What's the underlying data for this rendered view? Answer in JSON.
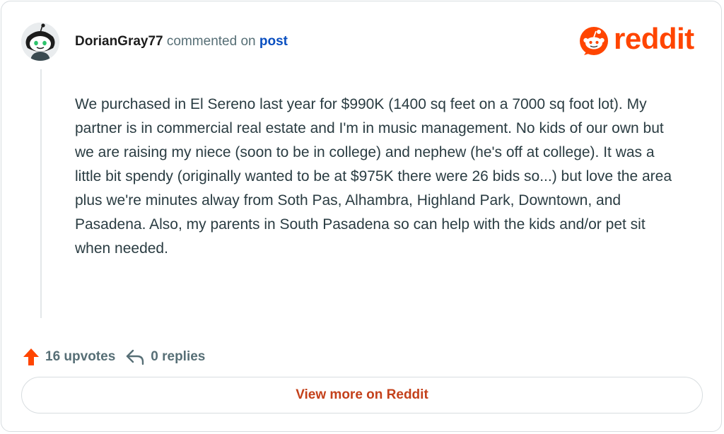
{
  "comment": {
    "author": "DorianGray77",
    "action_text": "commented on",
    "post_link": "post",
    "body": "We purchased in El Sereno last year for $990K (1400 sq feet on a 7000 sq foot lot). My partner is in commercial real estate and I'm in music management. No kids of our own but we are raising my niece (soon to be in college) and nephew (he's off at college). It was a little bit spendy (originally wanted to be at $975K there were 26 bids so...) but love the area plus we're minutes alway from Soth Pas, Alhambra, Highland Park, Downtown, and Pasadena. Also, my parents in South Pasadena so can help with the kids and/or pet sit when needed."
  },
  "brand": {
    "wordmark": "reddit",
    "color": "#ff4500"
  },
  "actions": {
    "upvotes": "16 upvotes",
    "replies": "0 replies"
  },
  "footer": {
    "view_more_label": "View more on Reddit"
  },
  "icons": {
    "avatar": "snoo-avatar",
    "logo": "reddit-snoo-icon",
    "upvote": "upvote-arrow-icon",
    "reply": "reply-arrow-icon"
  }
}
